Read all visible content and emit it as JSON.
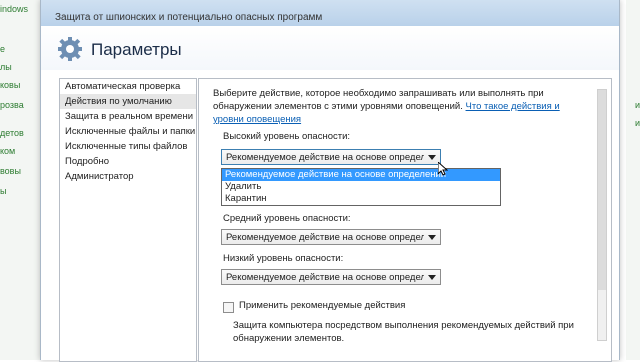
{
  "background": {
    "left_window_texts": [
      "indows",
      "е",
      "лы",
      "ковы",
      "розва",
      "детов",
      "ком",
      "вовы",
      "ы"
    ],
    "right_window_texts": [
      "и",
      "и"
    ]
  },
  "window": {
    "titlebar_text": "Защита от шпионских  и потенциально опасных программ",
    "dialog_title": "Параметры"
  },
  "nav": {
    "items": [
      {
        "label": "Автоматическая проверка",
        "selected": false
      },
      {
        "label": "Действия по умолчанию",
        "selected": true
      },
      {
        "label": "Защита в реальном времени",
        "selected": false
      },
      {
        "label": "Исключенные файлы и папки",
        "selected": false
      },
      {
        "label": "Исключенные типы файлов",
        "selected": false
      },
      {
        "label": "Подробно",
        "selected": false
      },
      {
        "label": "Администратор",
        "selected": false
      }
    ]
  },
  "content": {
    "description_text": "Выберите действие, которое необходимо запрашивать или выполнять при обнаружении элементов с этими уровнями оповещений.",
    "description_link": "Что такое действия и уровни оповещения",
    "high_label": "Высокий уровень опасности:",
    "high_value": "Рекомендуемое действие на основе определений",
    "dropdown_options": [
      {
        "label": "Рекомендуемое действие на основе определений",
        "active": true
      },
      {
        "label": "Удалить",
        "active": false
      },
      {
        "label": "Карантин",
        "active": false
      }
    ],
    "medium_label": "Средний уровень опасности:",
    "medium_value": "Рекомендуемое действие на основе определений",
    "low_label": "Низкий уровень опасности:",
    "low_value": "Рекомендуемое действие на основе определений",
    "apply_checkbox_label": "Применить рекомендуемые действия",
    "apply_checkbox_checked": false,
    "bottom_text": "Защита компьютера посредством выполнения рекомендуемых действий при обнаружении элементов."
  }
}
